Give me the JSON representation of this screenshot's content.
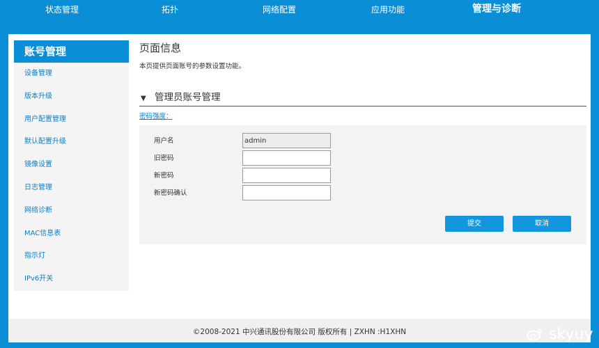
{
  "topnav": {
    "items": [
      {
        "label": "状态管理"
      },
      {
        "label": "拓扑"
      },
      {
        "label": "网络配置"
      },
      {
        "label": "应用功能"
      },
      {
        "label": "管理与诊断"
      }
    ],
    "active_index": 4
  },
  "sidebar": {
    "header": "账号管理",
    "items": [
      {
        "label": "设备管理"
      },
      {
        "label": "版本升级"
      },
      {
        "label": "用户配置管理"
      },
      {
        "label": "默认配置升级"
      },
      {
        "label": "镜像设置"
      },
      {
        "label": "日志管理"
      },
      {
        "label": "网络诊断"
      },
      {
        "label": "MAC信息表"
      },
      {
        "label": "指示灯"
      },
      {
        "label": "IPv6开关"
      }
    ]
  },
  "page": {
    "title": "页面信息",
    "description": "本页提供页面账号的参数设置功能。"
  },
  "section": {
    "toggle_icon": "▼",
    "title": "管理员账号管理"
  },
  "password_strength_label": "密码强度：",
  "form": {
    "username_label": "用户名",
    "username_value": "admin",
    "old_password_label": "旧密码",
    "old_password_value": "",
    "new_password_label": "新密码",
    "new_password_value": "",
    "confirm_password_label": "新密码确认",
    "confirm_password_value": ""
  },
  "buttons": {
    "submit": "提交",
    "cancel": "取消"
  },
  "footer": {
    "text": "©2008-2021 中兴通讯股份有限公司 版权所有 |   ZXHN  :H1XHN"
  },
  "watermark": {
    "icon": "weibo-icon",
    "text": "skyuy"
  },
  "colors": {
    "primary_blue": "#0a8fd6",
    "button_blue": "#1396de",
    "link_blue": "#0b7fc6"
  }
}
